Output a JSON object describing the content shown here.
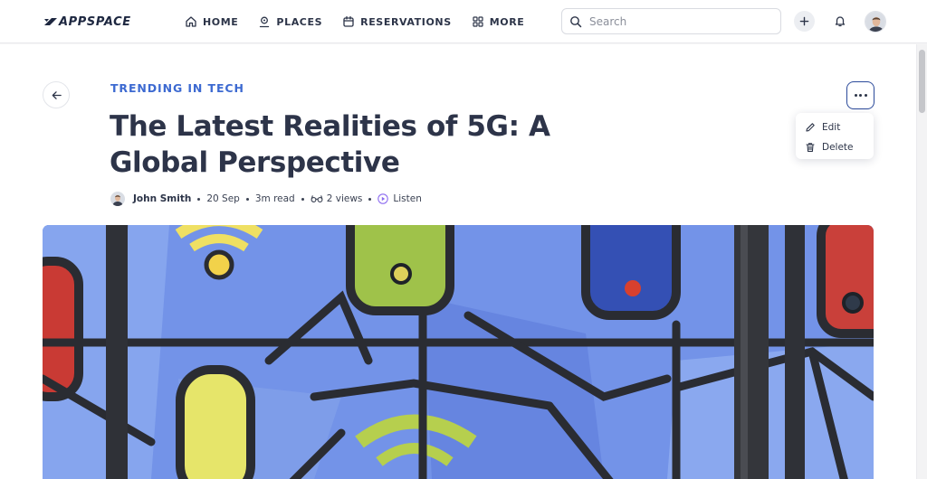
{
  "app": {
    "brand": "APPSPACE"
  },
  "nav": {
    "items": [
      {
        "label": "HOME",
        "icon": "home-icon"
      },
      {
        "label": "PLACES",
        "icon": "places-icon"
      },
      {
        "label": "RESERVATIONS",
        "icon": "calendar-icon"
      },
      {
        "label": "MORE",
        "icon": "grid-icon"
      }
    ]
  },
  "search": {
    "placeholder": "Search",
    "value": ""
  },
  "article": {
    "category": "TRENDING IN TECH",
    "title": "The Latest Realities of 5G: A Global Perspective",
    "author": "John Smith",
    "date": "20 Sep",
    "read_time": "3m read",
    "views": "2 views",
    "listen_label": "Listen"
  },
  "actions_menu": {
    "items": [
      {
        "label": "Edit",
        "icon": "pencil-icon"
      },
      {
        "label": "Delete",
        "icon": "trash-icon"
      }
    ]
  },
  "colors": {
    "accent": "#3d6ad1",
    "text": "#2c3448",
    "menu_border": "#2b4a9a"
  }
}
